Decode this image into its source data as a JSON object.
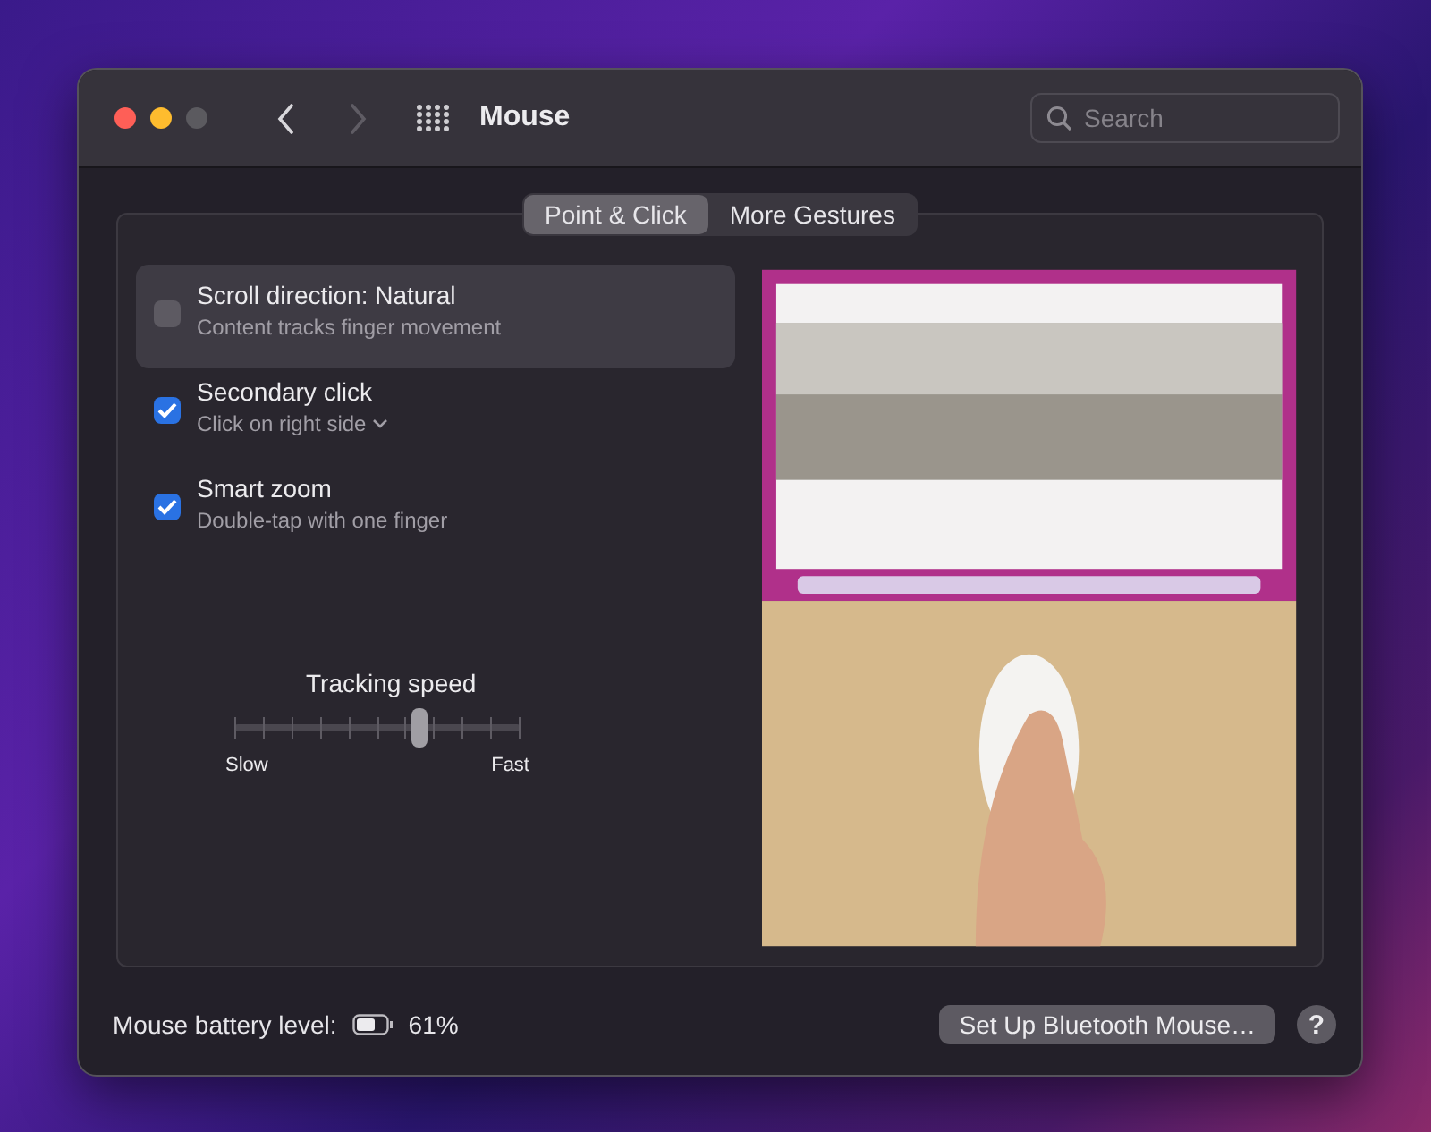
{
  "window": {
    "title": "Mouse",
    "traffic_lights": [
      {
        "color": "#fe5f57"
      },
      {
        "color": "#febc2e"
      },
      {
        "color": "#5b5a5f"
      }
    ],
    "nav": [
      {
        "kind": "back",
        "disabled": false
      },
      {
        "kind": "forward",
        "disabled": true
      }
    ]
  },
  "search": {
    "placeholder": "Search"
  },
  "tabs": [
    {
      "label": "Point & Click",
      "selected": true
    },
    {
      "label": "More Gestures",
      "selected": false
    }
  ],
  "options": [
    {
      "title": "Scroll direction: Natural",
      "subtitle": "Content tracks finger movement",
      "checked": false,
      "selected": true,
      "dropdown": false
    },
    {
      "title": "Secondary click",
      "subtitle": "Click on right side",
      "checked": true,
      "selected": false,
      "dropdown": true
    },
    {
      "title": "Smart zoom",
      "subtitle": "Double-tap with one finger",
      "checked": true,
      "selected": false,
      "dropdown": false
    }
  ],
  "tracking_speed": {
    "label": "Tracking speed",
    "level": 0.65,
    "min_label": "Slow",
    "max_label": "Fast"
  },
  "footer": {
    "battery_label": "Mouse battery level:",
    "battery_value": "61%",
    "setup_button": "Set Up Bluetooth Mouse…",
    "help_button": "?"
  }
}
